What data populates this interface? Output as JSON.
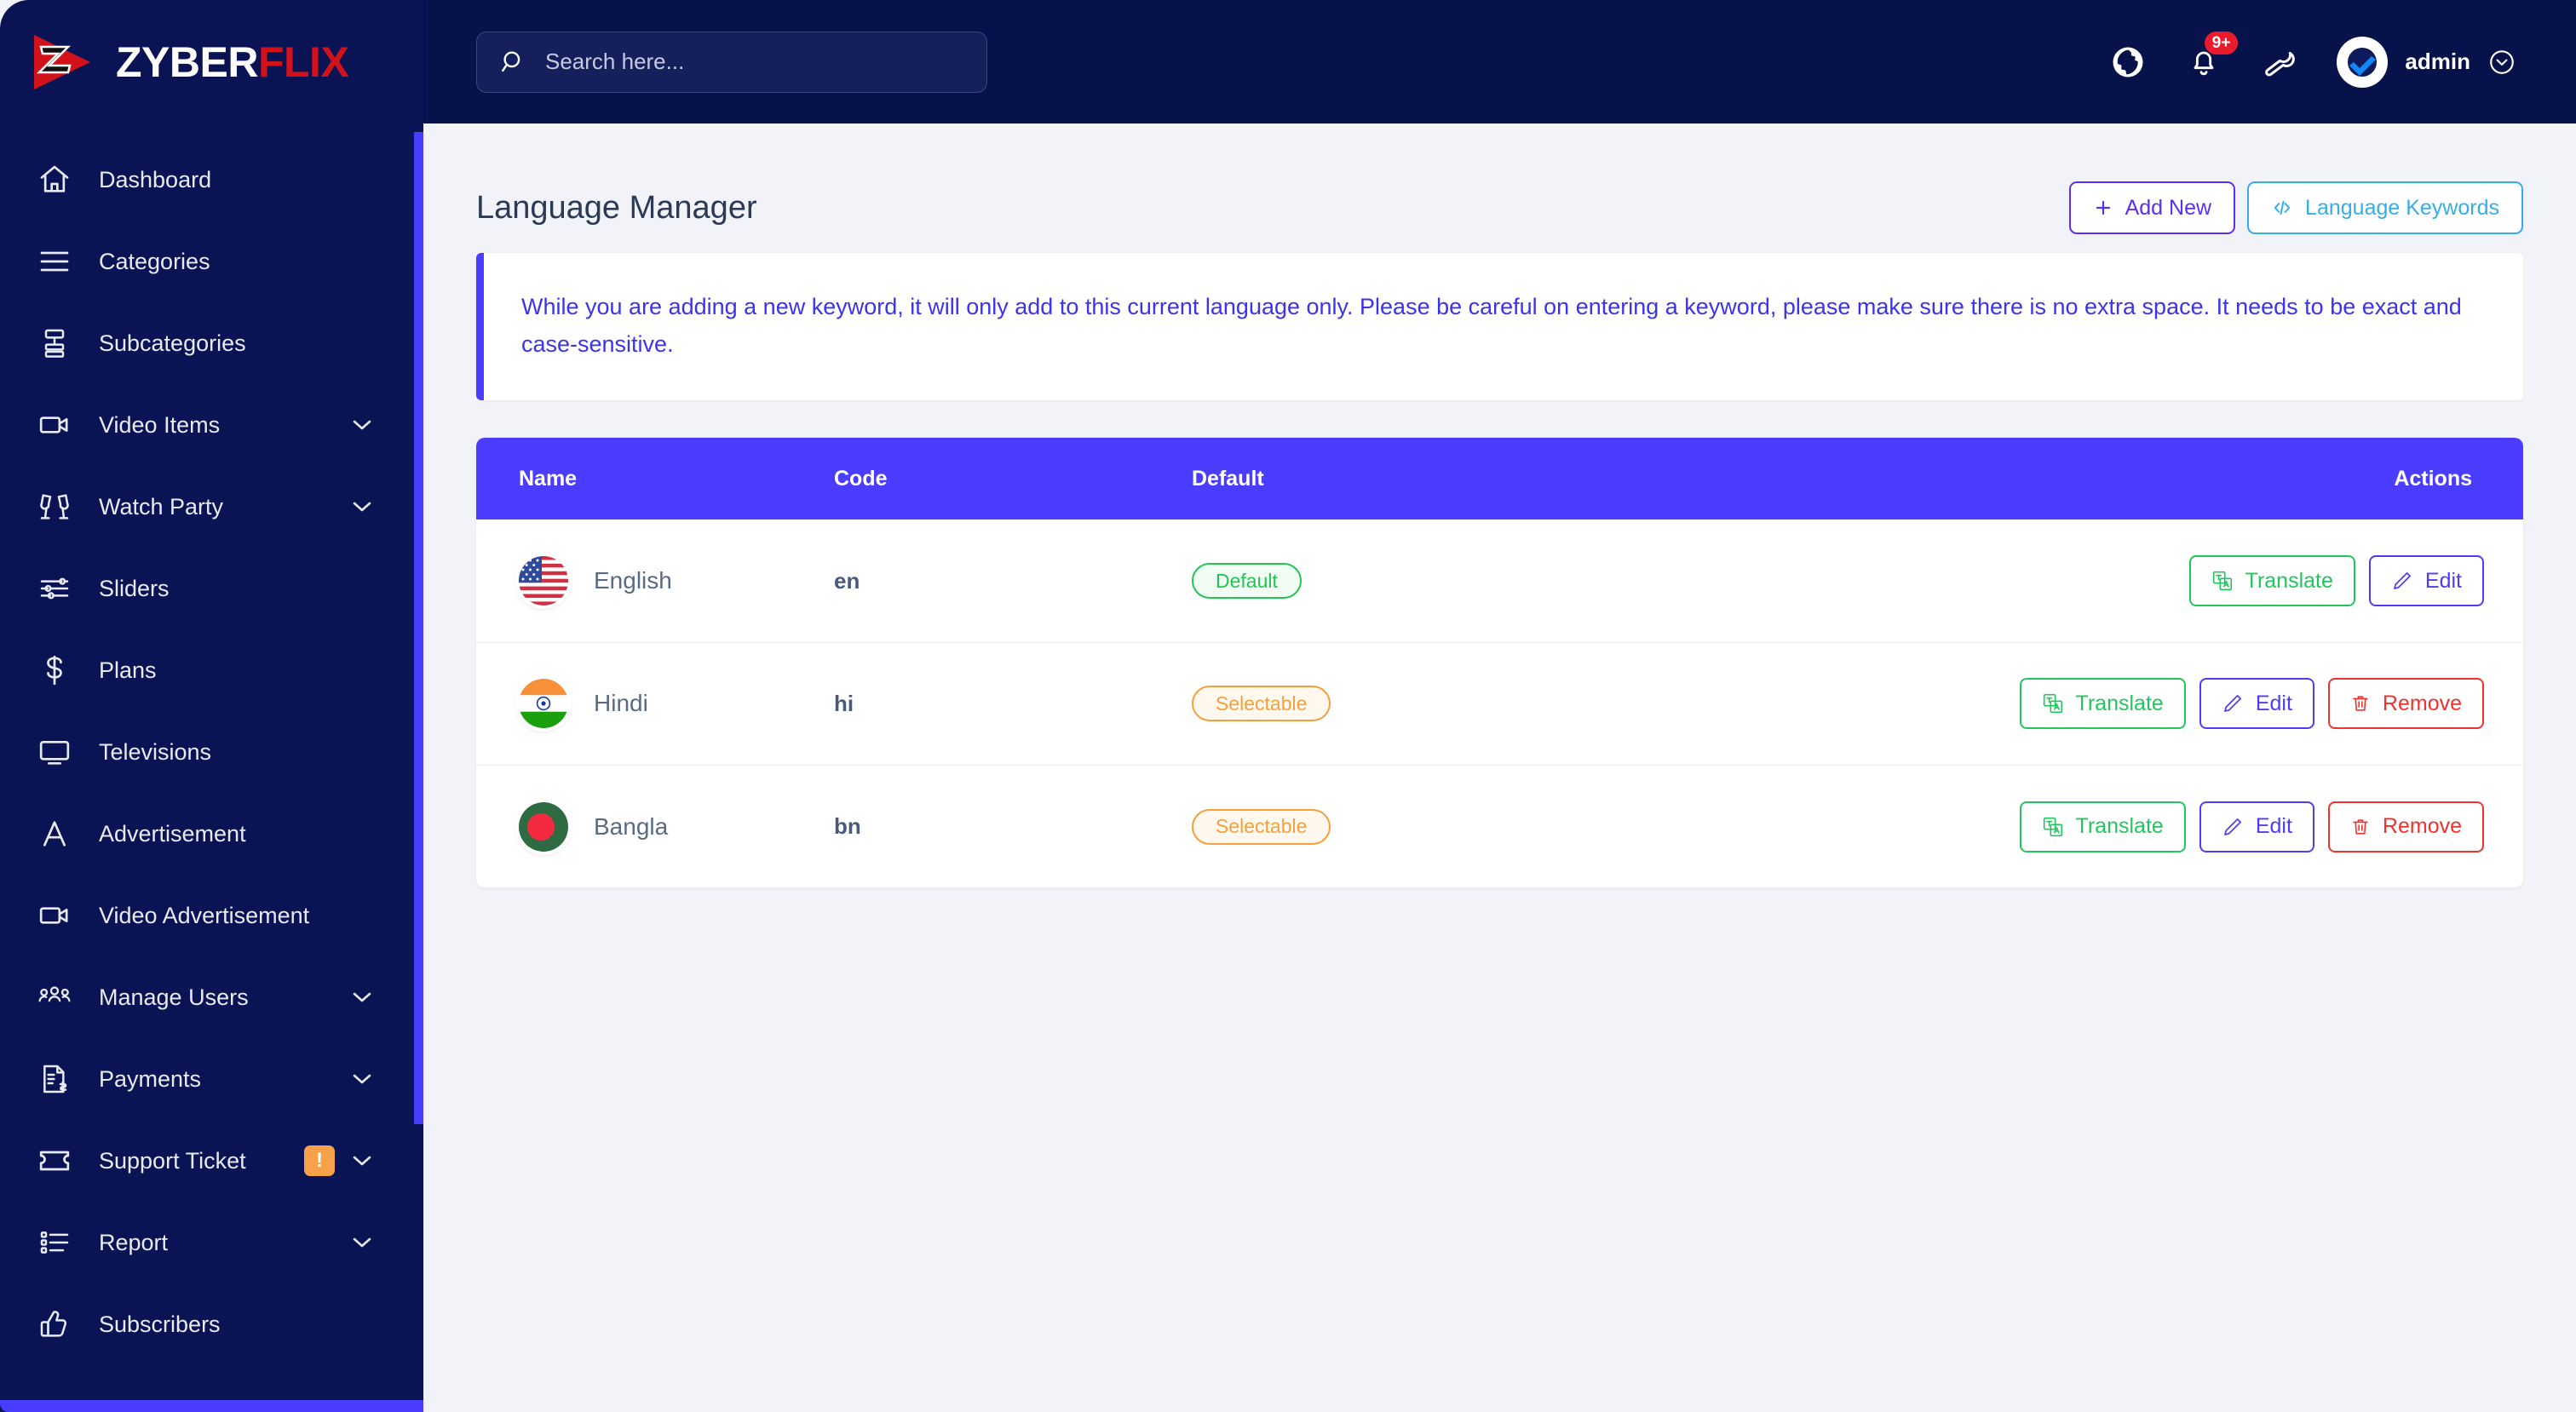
{
  "brand": {
    "name_part1": "ZYBER",
    "name_part2": "FLIX",
    "logo_icon": "play-triangle-z-icon",
    "color_primary": "#4b3dff",
    "color_sidebar": "#0a1455",
    "color_topbar": "#08124a"
  },
  "search": {
    "placeholder": "Search here...",
    "icon": "search-icon",
    "value": ""
  },
  "topbar": {
    "globe_icon": "globe-icon",
    "bell_icon": "bell-icon",
    "notification_count": "9+",
    "wrench_icon": "wrench-icon",
    "avatar_icon": "verified-check-avatar",
    "user_name": "admin",
    "user_chevron_icon": "chevron-down-circle-icon"
  },
  "sidebar": {
    "items": [
      {
        "label": "Dashboard",
        "icon": "home-icon",
        "chevron": false,
        "badge": null
      },
      {
        "label": "Categories",
        "icon": "list-lines-icon",
        "chevron": false,
        "badge": null
      },
      {
        "label": "Subcategories",
        "icon": "subcategory-icon",
        "chevron": false,
        "badge": null
      },
      {
        "label": "Video Items",
        "icon": "video-camera-icon",
        "chevron": true,
        "badge": null
      },
      {
        "label": "Watch Party",
        "icon": "cheers-glasses-icon",
        "chevron": true,
        "badge": null
      },
      {
        "label": "Sliders",
        "icon": "sliders-icon",
        "chevron": false,
        "badge": null
      },
      {
        "label": "Plans",
        "icon": "dollar-icon",
        "chevron": false,
        "badge": null
      },
      {
        "label": "Televisions",
        "icon": "monitor-icon",
        "chevron": false,
        "badge": null
      },
      {
        "label": "Advertisement",
        "icon": "letter-a-icon",
        "chevron": false,
        "badge": null
      },
      {
        "label": "Video Advertisement",
        "icon": "video-camera-icon",
        "chevron": false,
        "badge": null
      },
      {
        "label": "Manage Users",
        "icon": "users-group-icon",
        "chevron": true,
        "badge": null
      },
      {
        "label": "Payments",
        "icon": "invoice-dollar-icon",
        "chevron": true,
        "badge": null
      },
      {
        "label": "Support Ticket",
        "icon": "ticket-icon",
        "chevron": true,
        "badge": "!"
      },
      {
        "label": "Report",
        "icon": "report-list-icon",
        "chevron": true,
        "badge": null
      },
      {
        "label": "Subscribers",
        "icon": "thumbs-up-icon",
        "chevron": false,
        "badge": null
      }
    ]
  },
  "page": {
    "title": "Language Manager",
    "add_new_label": "Add New",
    "add_new_icon": "plus-icon",
    "keywords_label": "Language Keywords",
    "keywords_icon": "code-brackets-icon",
    "alert_text": "While you are adding a new keyword, it will only add to this current language only. Please be careful on entering a keyword, please make sure there is no extra space. It needs to be exact and case-sensitive."
  },
  "table": {
    "columns": [
      "Name",
      "Code",
      "Default",
      "Actions"
    ],
    "rows": [
      {
        "flag": "flag-usa",
        "name": "English",
        "code": "en",
        "status": "Default",
        "status_type": "default",
        "actions": [
          {
            "label": "Translate",
            "icon": "translate-icon",
            "kind": "translate"
          },
          {
            "label": "Edit",
            "icon": "pencil-icon",
            "kind": "edit"
          }
        ]
      },
      {
        "flag": "flag-india",
        "name": "Hindi",
        "code": "hi",
        "status": "Selectable",
        "status_type": "selectable",
        "actions": [
          {
            "label": "Translate",
            "icon": "translate-icon",
            "kind": "translate"
          },
          {
            "label": "Edit",
            "icon": "pencil-icon",
            "kind": "edit"
          },
          {
            "label": "Remove",
            "icon": "trash-icon",
            "kind": "remove"
          }
        ]
      },
      {
        "flag": "flag-bangladesh",
        "name": "Bangla",
        "code": "bn",
        "status": "Selectable",
        "status_type": "selectable",
        "actions": [
          {
            "label": "Translate",
            "icon": "translate-icon",
            "kind": "translate"
          },
          {
            "label": "Edit",
            "icon": "pencil-icon",
            "kind": "edit"
          },
          {
            "label": "Remove",
            "icon": "trash-icon",
            "kind": "remove"
          }
        ]
      }
    ]
  }
}
